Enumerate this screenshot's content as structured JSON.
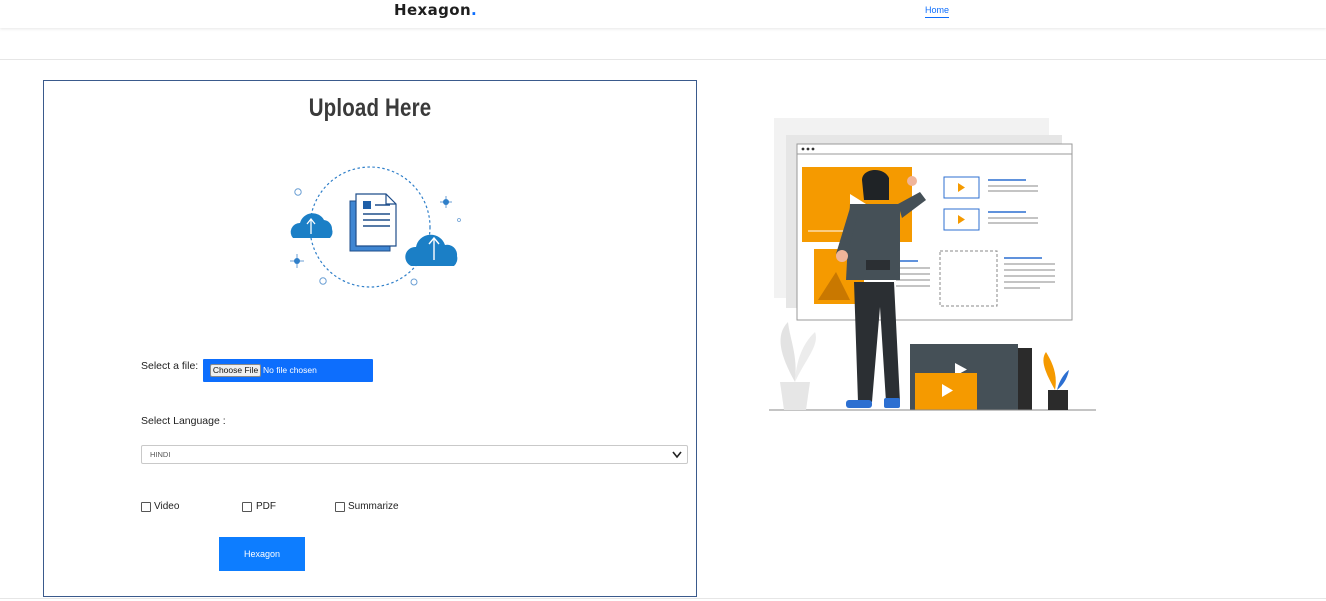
{
  "nav": {
    "brand": "Hexagon",
    "brand_dot": ".",
    "home_link": "Home"
  },
  "upload": {
    "title": "Upload Here",
    "file_label": "Select a file:",
    "choose_file": "Choose File",
    "no_file": "No file chosen",
    "language_label": "Select Language :",
    "language_value": "HINDI",
    "options": [
      {
        "label": "Video",
        "checked": false
      },
      {
        "label": "PDF",
        "checked": false
      },
      {
        "label": "Summarize",
        "checked": false
      }
    ],
    "submit_label": "Hexagon"
  },
  "colors": {
    "accent": "#0d6efd",
    "button": "#0d7dff",
    "cloud": "#1b7fc6",
    "orange": "#f59a00",
    "card_border": "#3a5a8c"
  },
  "icons": {
    "upload_illustration": "cloud-upload-document-icon",
    "hero_illustration": "person-arranging-media-illustration"
  }
}
